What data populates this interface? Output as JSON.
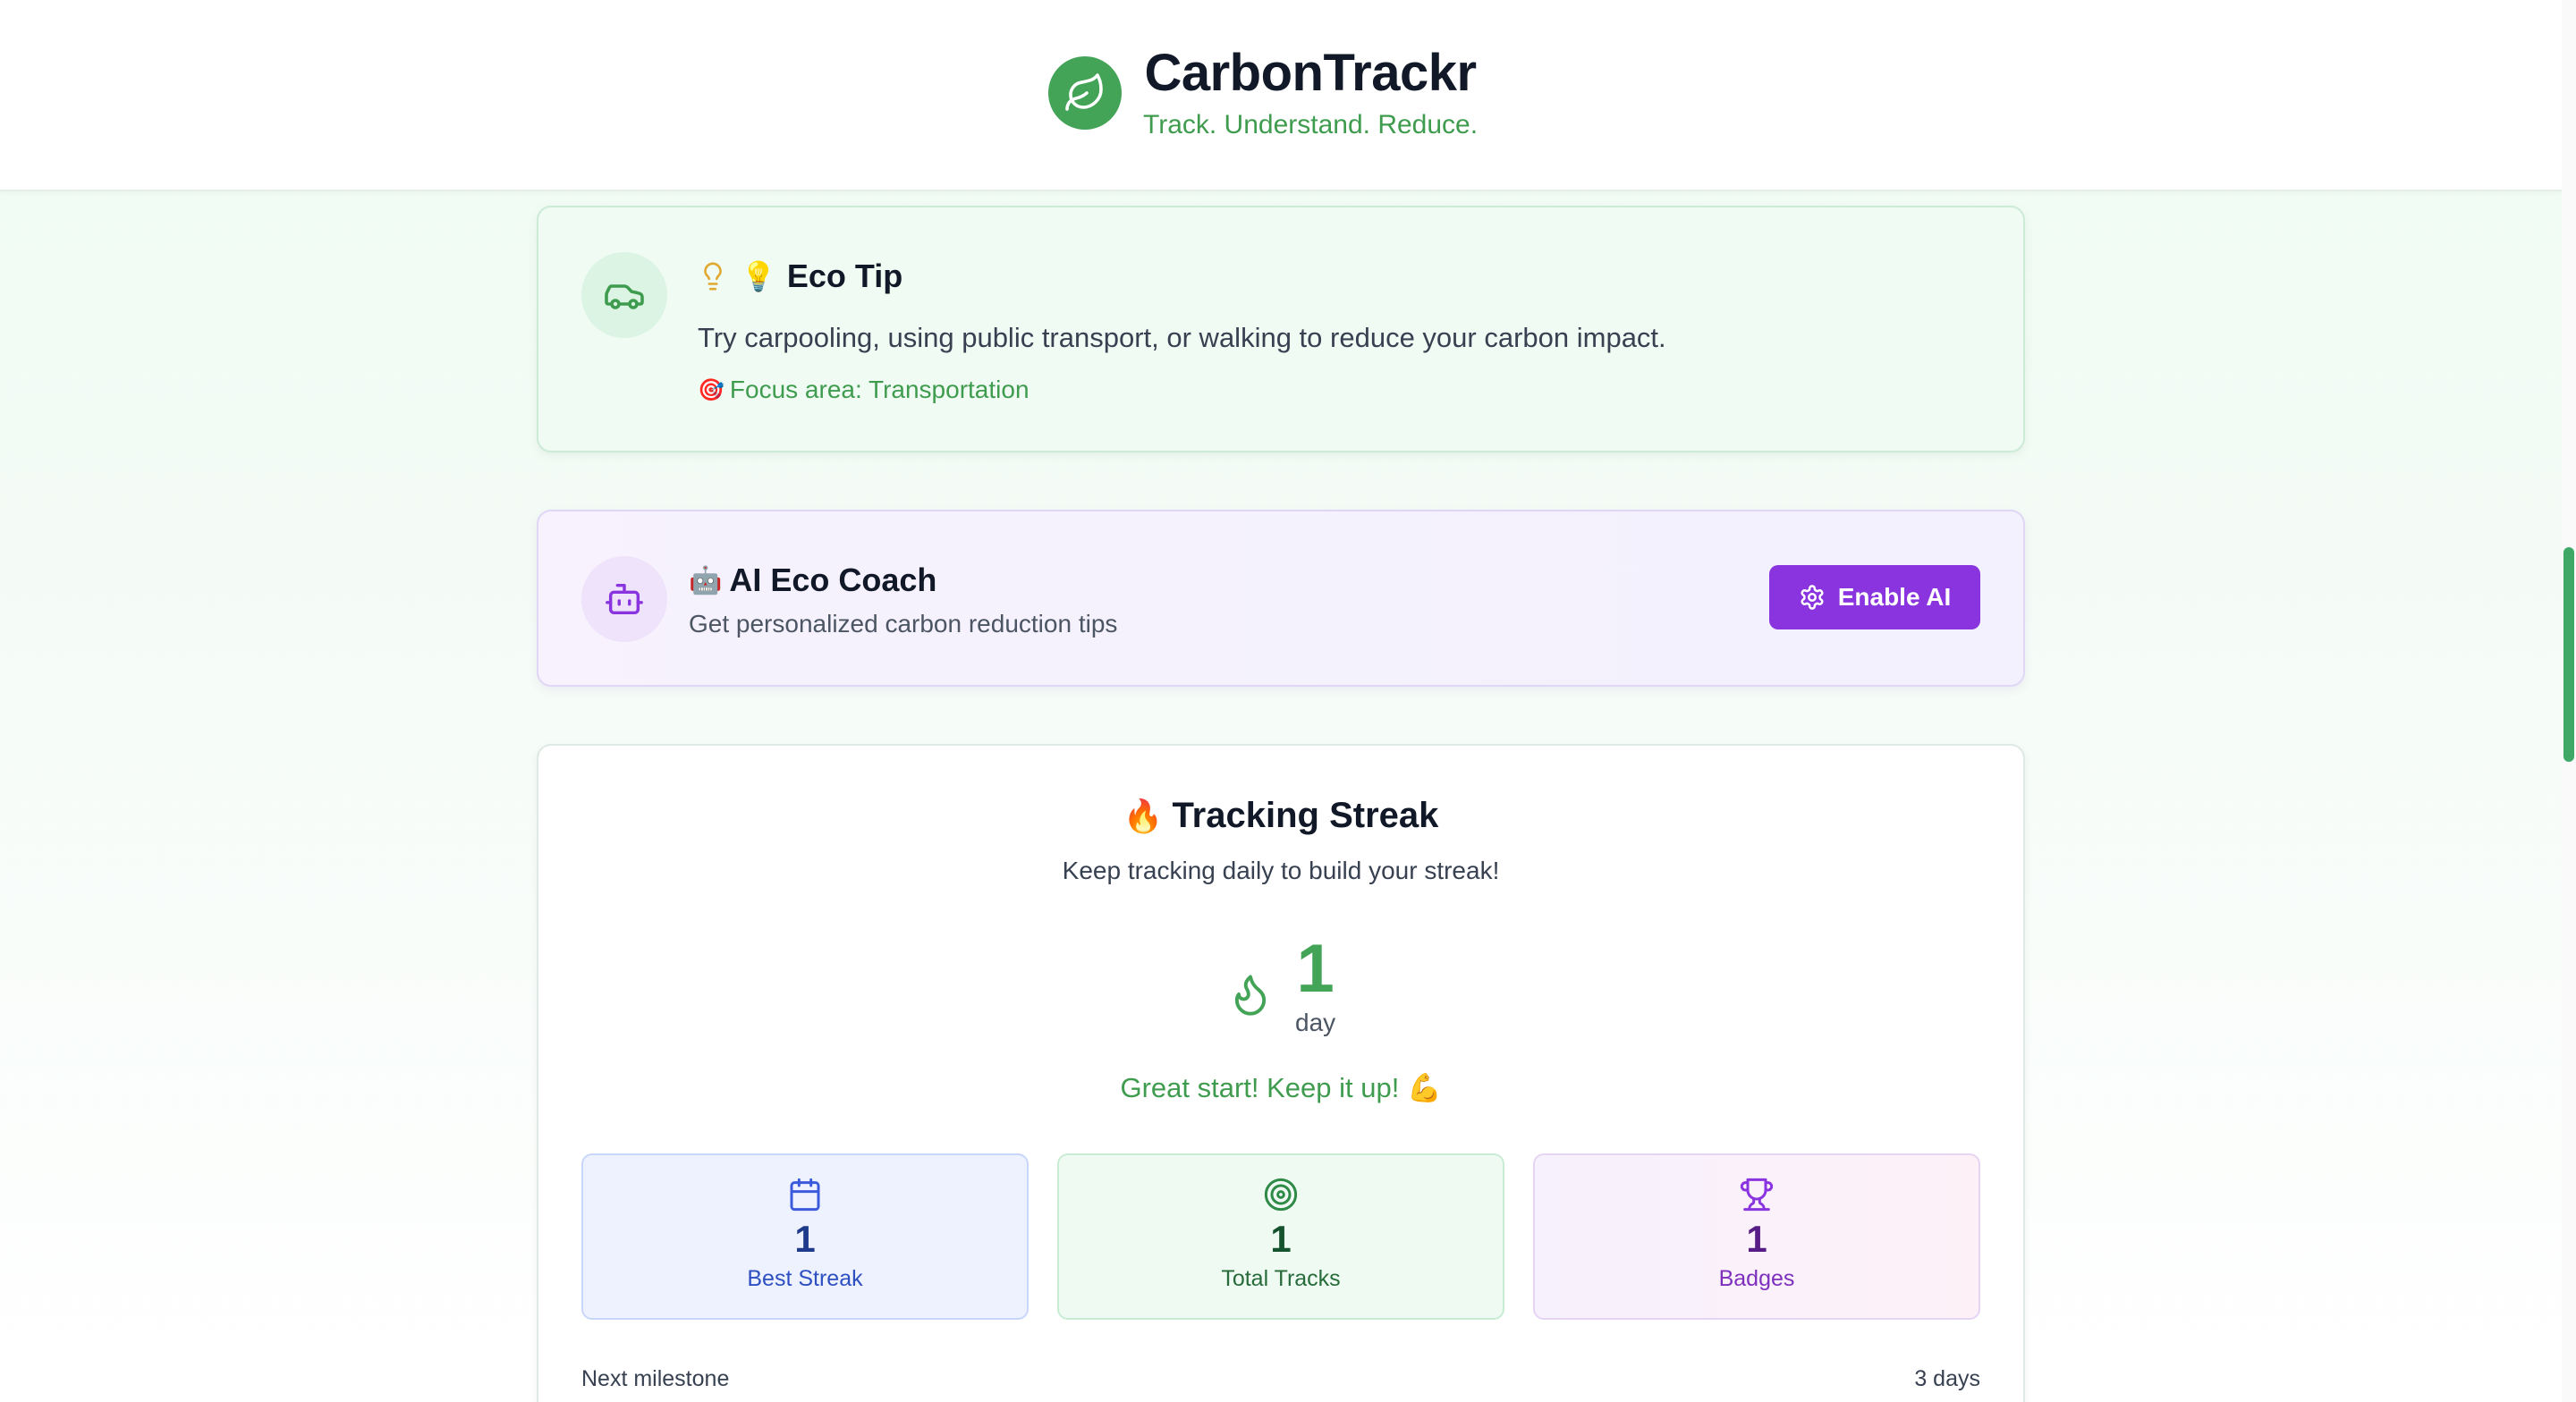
{
  "header": {
    "title": "CarbonTrackr",
    "tagline": "Track. Understand. Reduce.",
    "logo_icon": "leaf-icon"
  },
  "eco_tip": {
    "icon": "car-icon",
    "title_icon": "lightbulb-icon",
    "title_emoji": "💡",
    "title": "Eco Tip",
    "body": "Try carpooling, using public transport, or walking to reduce your carbon impact.",
    "focus_emoji": "🎯",
    "focus": "Focus area: Transportation"
  },
  "ai_coach": {
    "icon": "bot-icon",
    "title_emoji": "🤖",
    "title": "AI Eco Coach",
    "subtitle": "Get personalized carbon reduction tips",
    "button_label": "Enable AI",
    "button_icon": "gear-icon"
  },
  "streak": {
    "title_emoji": "🔥",
    "title": "Tracking Streak",
    "subtitle": "Keep tracking daily to build your streak!",
    "count": "1",
    "unit": "day",
    "message": "Great start! Keep it up! 💪",
    "stats": {
      "best": {
        "value": "1",
        "label": "Best Streak",
        "icon": "calendar-icon"
      },
      "total": {
        "value": "1",
        "label": "Total Tracks",
        "icon": "target-icon"
      },
      "badges": {
        "value": "1",
        "label": "Badges",
        "icon": "trophy-icon"
      }
    },
    "milestone_label": "Next milestone",
    "milestone_value": "3 days"
  },
  "colors": {
    "brand_green": "#43a357",
    "accent_purple": "#8a34e0",
    "scroll_thumb": "#3fa867"
  }
}
